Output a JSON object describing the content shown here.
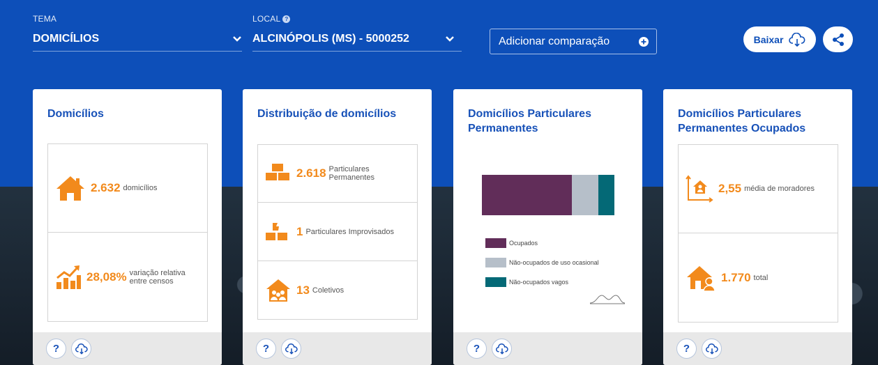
{
  "header": {
    "tema": {
      "label": "TEMA",
      "value": "DOMICÍLIOS"
    },
    "local": {
      "label": "LOCAL",
      "value": "ALCINÓPOLIS (MS) - 5000252"
    },
    "compare_label": "Adicionar comparação",
    "download_label": "Baixar"
  },
  "footer": {
    "help": "?"
  },
  "cards": [
    {
      "title": "Domicílios",
      "stats": [
        {
          "value": "2.632",
          "label": "domicílios",
          "icon": "house-icon"
        },
        {
          "value": "28,08%",
          "label": "variação relativa entre censos",
          "icon": "growth-chart-icon"
        }
      ]
    },
    {
      "title": "Distribuição de domicílios",
      "stats": [
        {
          "value": "2.618",
          "label": "Particulares Permanentes",
          "icon": "bricks-icon"
        },
        {
          "value": "1",
          "label": "Particulares Improvisados",
          "icon": "broken-bricks-icon"
        },
        {
          "value": "13",
          "label": "Coletivos",
          "icon": "group-house-icon"
        }
      ]
    },
    {
      "title": "Domicílios Particulares Permanentes"
    },
    {
      "title": "Domicílios Particulares Permanentes Ocupados",
      "stats": [
        {
          "value": "2,55",
          "label": "média de moradores",
          "icon": "person-axis-icon"
        },
        {
          "value": "1.770",
          "label": "total",
          "icon": "house-person-icon"
        }
      ]
    }
  ],
  "chart_data": {
    "type": "bar",
    "orientation": "horizontal-stacked",
    "series": [
      {
        "name": "Ocupados",
        "value": 0.68,
        "color": "#612d59"
      },
      {
        "name": "Não-ocupados de uso ocasional",
        "value": 0.2,
        "color": "#b6bfc9"
      },
      {
        "name": "Não-ocupados vagos",
        "value": 0.12,
        "color": "#046976"
      }
    ],
    "colors": {
      "accent": "#f28a1c",
      "title": "#1751b8",
      "header": "#0d4fb9"
    }
  }
}
